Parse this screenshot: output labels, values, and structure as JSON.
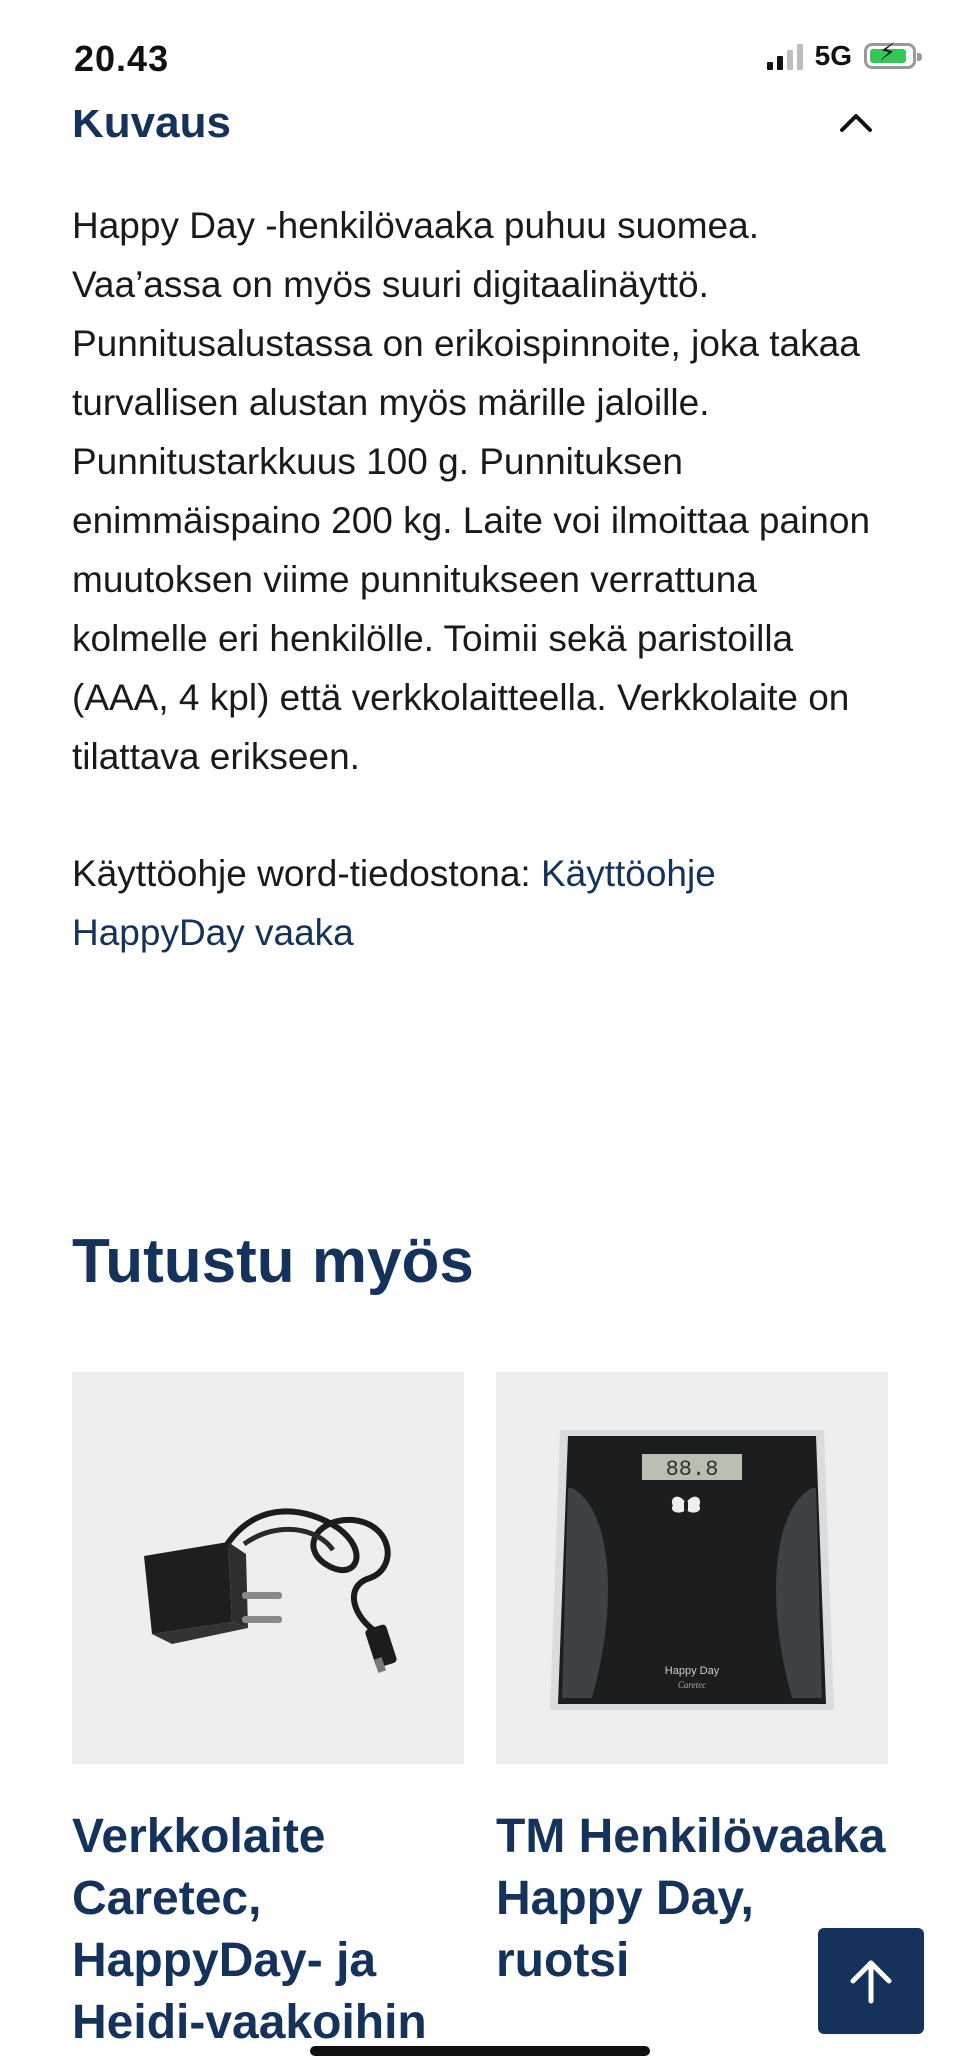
{
  "status_bar": {
    "time": "20.43",
    "network": "5G"
  },
  "section": {
    "title": "Kuvaus"
  },
  "description": "Happy Day -henkilövaaka puhuu suomea. Vaa’assa on myös suuri digitaalinäyttö. Punnitusalustassa on erikoispinnoite, joka takaa turvallisen alustan myös märille jaloille. Punnitustarkkuus 100 g. Punnituksen enimmäispaino 200 kg. Laite voi ilmoittaa painon muutoksen viime punnitukseen verrattuna kolmelle eri henkilölle. Toimii sekä paristoilla (AAA, 4 kpl) että verkkolaitteella. Verkkolaite on tilattava erikseen.",
  "manual": {
    "prefix": "Käyttöohje word-tiedostona: ",
    "link_text": "Käyttöohje HappyDay vaaka"
  },
  "see_also": {
    "title": "Tutustu myös",
    "products": [
      {
        "name": "Verkkolaite Caretec, HappyDay- ja Heidi-vaakoihin",
        "image_icon": "power-adapter-icon"
      },
      {
        "name": "TM Henkilövaaka Happy Day, ruotsi",
        "image_icon": "bathroom-scale-icon"
      }
    ]
  },
  "scale_image": {
    "brand_line1": "Happy Day",
    "brand_line2": "Caretec"
  },
  "back_to_top_icon": "arrow-up-icon",
  "colors": {
    "brand": "#14325a",
    "text": "#1a1a1a",
    "thumb_bg": "#eeeeee",
    "battery": "#34c759"
  }
}
